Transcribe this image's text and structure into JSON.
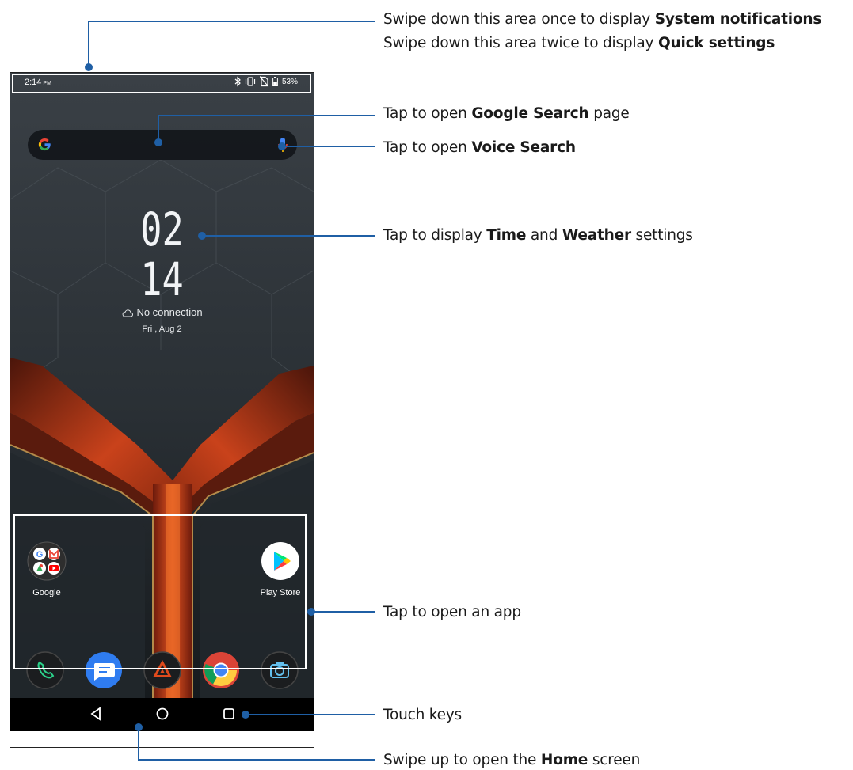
{
  "status_bar": {
    "time": "2:14",
    "ampm": "PM",
    "battery": "53%",
    "icons": [
      "bluetooth-icon",
      "vibrate-icon",
      "no-sim-icon",
      "battery-icon"
    ]
  },
  "search_bar": {
    "logo": "google-g-icon",
    "mic": "mic-icon"
  },
  "clock_widget": {
    "hour": "02",
    "minute": "14",
    "weather": "No connection",
    "weather_icon": "cloud-icon",
    "date": "Fri , Aug 2"
  },
  "apps": {
    "google_folder": "Google",
    "play_store": "Play Store"
  },
  "dock": [
    "phone-icon",
    "messages-icon",
    "armoury-icon",
    "chrome-icon",
    "camera-icon"
  ],
  "nav_keys": [
    "back-key",
    "home-key",
    "recents-key"
  ],
  "callouts": {
    "system_notifications": {
      "pre": "Swipe down this area once to display ",
      "bold": "System notifications"
    },
    "quick_settings": {
      "pre": "Swipe down this area twice to display ",
      "bold": "Quick settings"
    },
    "google_search": {
      "pre": "Tap to open ",
      "bold": "Google Search",
      "post": " page"
    },
    "voice_search": {
      "pre": "Tap to open ",
      "bold": "Voice Search"
    },
    "time_weather": {
      "pre": "Tap to display ",
      "bold1": "Time",
      "mid": " and ",
      "bold2": "Weather",
      "post": " settings"
    },
    "open_app": {
      "text": "Tap to open an app"
    },
    "touch_keys": {
      "text": "Touch keys"
    },
    "home_screen": {
      "pre": "Swipe up to open the ",
      "bold": "Home",
      "post": " screen"
    }
  },
  "colors": {
    "callout_line": "#1f5fa5",
    "highlight_box": "#ffffff",
    "glow": "#d8401a"
  }
}
